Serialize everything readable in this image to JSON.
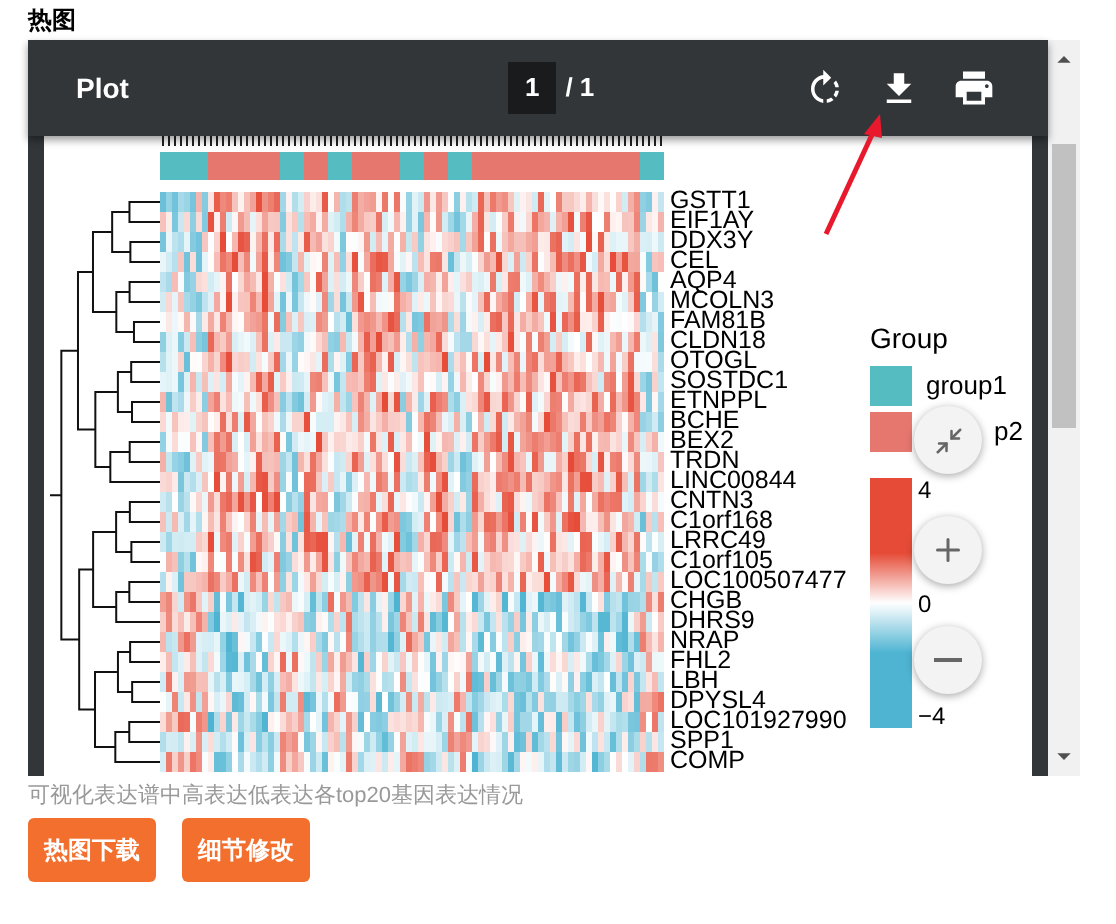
{
  "section_title": "热图",
  "viewer": {
    "title": "Plot",
    "page": "1",
    "page_total": "/ 1"
  },
  "genes": [
    "GSTT1",
    "EIF1AY",
    "DDX3Y",
    "CEL",
    "AQP4",
    "MCOLN3",
    "FAM81B",
    "CLDN18",
    "OTOGL",
    "SOSTDC1",
    "ETNPPL",
    "BCHE",
    "BEX2",
    "TRDN",
    "LINC00844",
    "CNTN3",
    "C1orf168",
    "LRRC49",
    "C1orf105",
    "LOC100507477",
    "CHGB",
    "DHRS9",
    "NRAP",
    "FHL2",
    "LBH",
    "DPYSL4",
    "LOC101927990",
    "SPP1",
    "COMP"
  ],
  "legend": {
    "title": "Group",
    "items": [
      {
        "label": "group1",
        "color": "#55bcc2"
      },
      {
        "label": "p2",
        "color": "#e6776f"
      }
    ],
    "scale_labels": [
      "4",
      "0",
      "−4"
    ]
  },
  "caption": "可视化表达谱中高表达低表达各top20基因表达情况",
  "buttons": [
    "热图下载",
    "细节修改"
  ]
}
